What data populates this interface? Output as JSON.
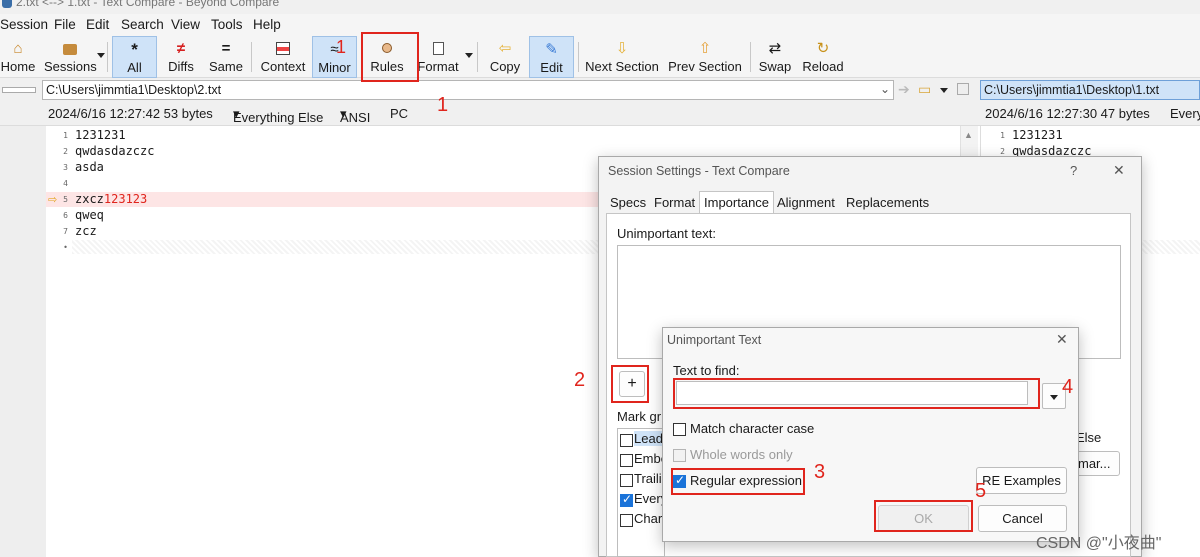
{
  "window": {
    "title": "2.txt <--> 1.txt - Text Compare - Beyond Compare"
  },
  "menu": [
    "Session",
    "File",
    "Edit",
    "Search",
    "View",
    "Tools",
    "Help"
  ],
  "toolbar": {
    "home": "Home",
    "sessions": "Sessions",
    "all": "All",
    "diffs": "Diffs",
    "same": "Same",
    "context": "Context",
    "minor": "Minor",
    "rules": "Rules",
    "format": "Format",
    "copy": "Copy",
    "edit": "Edit",
    "next_section": "Next Section",
    "prev_section": "Prev Section",
    "swap": "Swap",
    "reload": "Reload"
  },
  "left_file": {
    "path": "C:\\Users\\jimmtia1\\Desktop\\2.txt",
    "info": "2024/6/16 12:27:42   53 bytes",
    "filter": "Everything Else",
    "encoding": "ANSI",
    "line_end": "PC"
  },
  "right_file": {
    "path": "C:\\Users\\jimmtia1\\Desktop\\1.txt",
    "info": "2024/6/16 12:27:30   47 bytes",
    "filter": "Every"
  },
  "left_lines": [
    {
      "n": "1",
      "text": "1231231"
    },
    {
      "n": "2",
      "text": "qwdasdazczc"
    },
    {
      "n": "3",
      "text": "asda"
    },
    {
      "n": "4",
      "text": ""
    },
    {
      "n": "5",
      "text": "zxcz",
      "diff": "123123"
    },
    {
      "n": "6",
      "text": "qweq"
    },
    {
      "n": "7",
      "text": "zcz"
    },
    {
      "n": "•",
      "text": ""
    }
  ],
  "right_lines": [
    {
      "n": "1",
      "text": "1231231"
    },
    {
      "n": "2",
      "text": "qwdasdazczc"
    }
  ],
  "session_dialog": {
    "title": "Session Settings - Text Compare",
    "help": "?",
    "close": "✕",
    "tabs": [
      "Specs",
      "Format",
      "Importance",
      "Alignment",
      "Replacements"
    ],
    "unimportant_label": "Unimportant text:",
    "add": "+",
    "mark_label": "Mark gr",
    "mark_items": [
      "Lead",
      "Embe",
      "Traili",
      "Every",
      "Chara"
    ],
    "right_else": "Else",
    "right_btn": "mar..."
  },
  "text_dialog": {
    "title": "Unimportant Text",
    "close": "✕",
    "find_label": "Text to find:",
    "find_value": "",
    "match_case": "Match character case",
    "whole_words": "Whole words only",
    "regex": "Regular expression",
    "re_examples": "RE Examples",
    "ok": "OK",
    "cancel": "Cancel"
  },
  "annotations": {
    "n1a": "1",
    "n1b": "1",
    "n2": "2",
    "n3": "3",
    "n4": "4",
    "n5": "5"
  },
  "watermark": "CSDN @\"小夜曲\"",
  "colors": {
    "accent": "#1a73d9",
    "diff_bg": "#fde5e5",
    "diff_text": "#e0251d",
    "annotation": "#e0251d"
  }
}
